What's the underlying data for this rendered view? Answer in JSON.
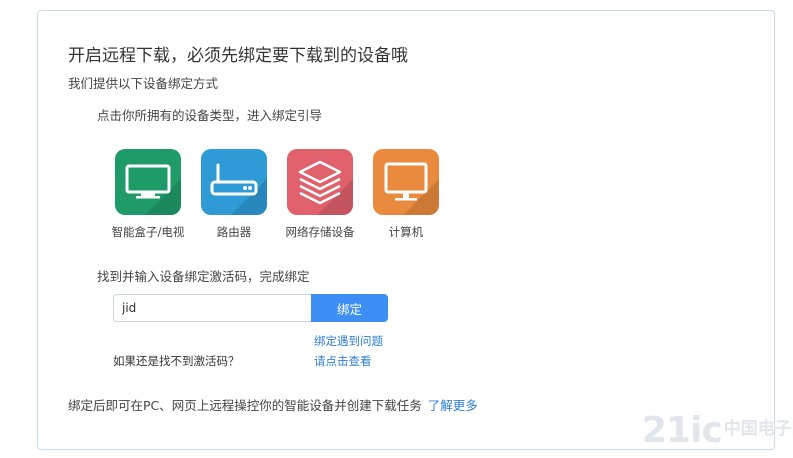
{
  "card": {
    "title": "开启远程下载，必须先绑定要下载到的设备哦",
    "subtitle": "我们提供以下设备绑定方式",
    "hint": "点击你所拥有的设备类型，进入绑定引导"
  },
  "devices": [
    {
      "label": "智能盒子/电视",
      "icon": "tv-icon",
      "color": "#1f9b6a"
    },
    {
      "label": "路由器",
      "icon": "router-icon",
      "color": "#2e9bd6"
    },
    {
      "label": "网络存储设备",
      "icon": "storage-layers-icon",
      "color": "#e0616b"
    },
    {
      "label": "计算机",
      "icon": "monitor-icon",
      "color": "#ea8a3e"
    }
  ],
  "activation": {
    "title": "找到并输入设备绑定激活码，完成绑定",
    "input_value": "jid",
    "bind_label": "绑定",
    "problem_link": "绑定遇到问题",
    "not_found_text": "如果还是找不到激活码？",
    "check_link": "请点击查看"
  },
  "footer": {
    "text": "绑定后即可在PC、网页上远程操控你的智能设备并创建下载任务",
    "more_link": "了解更多"
  },
  "watermark": {
    "main": "21ic",
    "sub": "中国电子网"
  }
}
